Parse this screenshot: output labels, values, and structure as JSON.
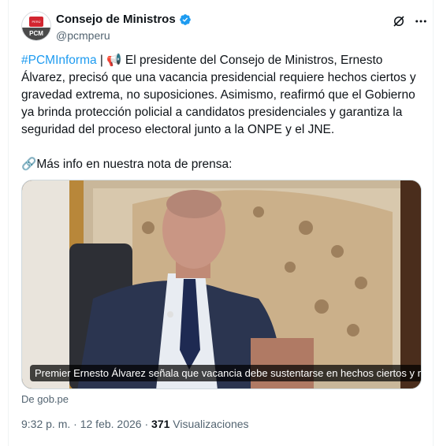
{
  "account": {
    "display_name": "Consejo de Ministros",
    "handle": "@pcmperu",
    "avatar_flag_text": "PERÚ",
    "avatar_text": "PCM"
  },
  "tweet": {
    "hashtag": "#PCMInforma",
    "separator": " | ",
    "emoji_megaphone": "📢",
    "body": " El presidente del Consejo de Ministros, Ernesto Álvarez, precisó que una vacancia presidencial requiere hechos ciertos y gravedad extrema, no suposiciones. Asimismo, reafirmó que el Gobierno ya brinda protección policial a candidatos presidenciales y garantiza la seguridad del proceso electoral junto a la ONPE y el JNE.",
    "emoji_link": "🔗",
    "more_info": "Más info en nuestra nota de prensa:"
  },
  "link_card": {
    "caption": "Premier Ernesto Álvarez señala que vacancia debe sustentarse en hechos ciertos y no ...",
    "source": "De gob.pe"
  },
  "meta": {
    "time": "9:32 p. m.",
    "dot1": " · ",
    "date": "12 feb. 2026",
    "dot2": " · ",
    "views_count": "371",
    "views_label": " Visualizaciones"
  },
  "colors": {
    "link_blue": "#1d9bf0",
    "secondary_text": "#536471",
    "verified_blue": "#1d9bf0"
  }
}
